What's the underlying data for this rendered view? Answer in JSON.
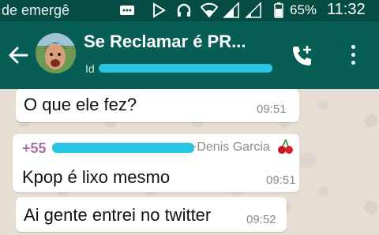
{
  "status_bar": {
    "carrier_text": "de emergê",
    "battery_percent": "65%",
    "time": "11:32",
    "icons": [
      "message-icon",
      "play-store-icon",
      "headphones-icon",
      "wifi-icon",
      "signal-icon",
      "signal-icon-2",
      "battery-icon"
    ]
  },
  "header": {
    "title": "Se Reclamar é PR...",
    "subtitle_visible": "Id",
    "colors": {
      "app_bar": "#075e54",
      "status_bar": "#054d44"
    }
  },
  "messages": [
    {
      "text": "O que ele fez?",
      "time": "09:51"
    },
    {
      "sender_number": "+55",
      "sender_name": "~Denis Garcia",
      "text": "Kpop é lixo mesmo",
      "time": "09:51"
    },
    {
      "text": "Ai gente entrei no twitter",
      "time": "09:52"
    }
  ]
}
